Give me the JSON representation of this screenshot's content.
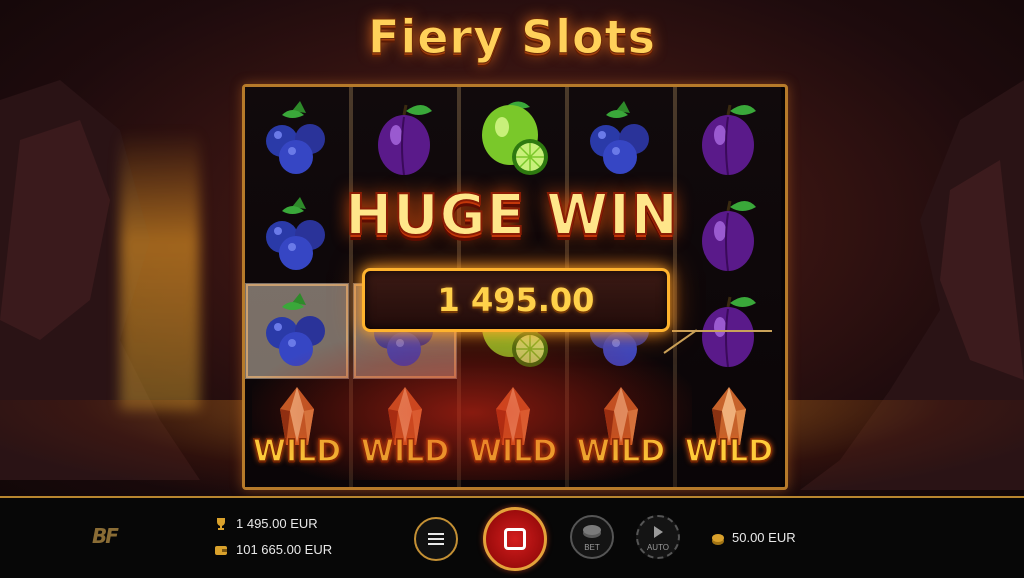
{
  "game": {
    "title": "Fiery Slots",
    "big_win_label": "HUGE WIN",
    "big_win_amount": "1 495.00"
  },
  "reels": [
    [
      "blueberries",
      "blueberries",
      "blueberries",
      "wild"
    ],
    [
      "plum",
      "blank",
      "blueberries",
      "wild"
    ],
    [
      "lime",
      "blank",
      "lime",
      "wild"
    ],
    [
      "blueberries",
      "blank",
      "blueberries",
      "wild"
    ],
    [
      "plum",
      "plum",
      "plum",
      "wild"
    ]
  ],
  "symbols": {
    "wild_label": "WILD"
  },
  "bottom_bar": {
    "logo": "BF",
    "last_win": "1 495.00 EUR",
    "balance": "101 665.00 EUR",
    "bet_label": "BET",
    "auto_label": "AUTO",
    "bet_amount": "50.00 EUR"
  },
  "colors": {
    "accent_gold": "#c49034",
    "spin_red": "#c41414",
    "win_text": "#ffd14a"
  }
}
